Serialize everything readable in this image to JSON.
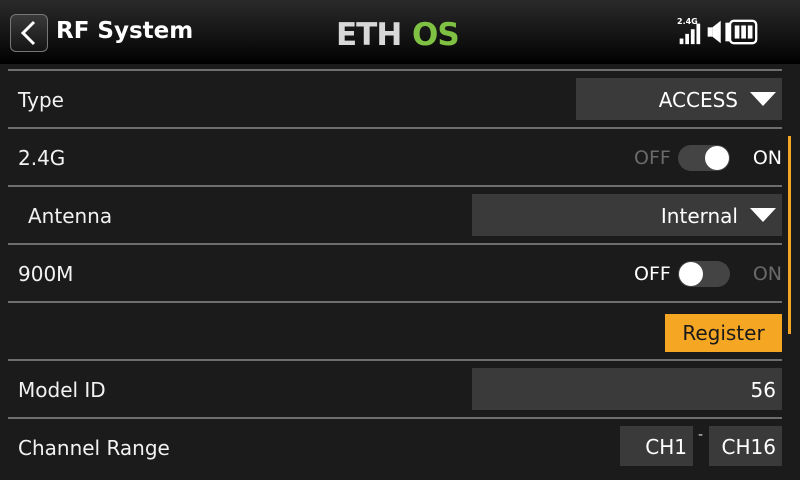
{
  "header": {
    "title": "RF System",
    "logo_text": "ETHOS",
    "rf_indicator": "2.4G",
    "icons": [
      "back-icon",
      "signal-strength-icon",
      "speaker-icon",
      "battery-icon"
    ],
    "accent_color": "#f5a623",
    "logo_green": "#7fc142"
  },
  "rows": {
    "type": {
      "label": "Type",
      "value": "ACCESS"
    },
    "rf24": {
      "label": "2.4G",
      "off_label": "OFF",
      "on_label": "ON",
      "state": "on"
    },
    "antenna": {
      "label": "Antenna",
      "value": "Internal"
    },
    "rf900": {
      "label": "900M",
      "off_label": "OFF",
      "on_label": "ON",
      "state": "off"
    },
    "register": {
      "button_label": "Register"
    },
    "model_id": {
      "label": "Model ID",
      "value": "56"
    },
    "channel_range": {
      "label": "Channel Range",
      "start": "CH1",
      "separator": "-",
      "end": "CH16"
    }
  }
}
